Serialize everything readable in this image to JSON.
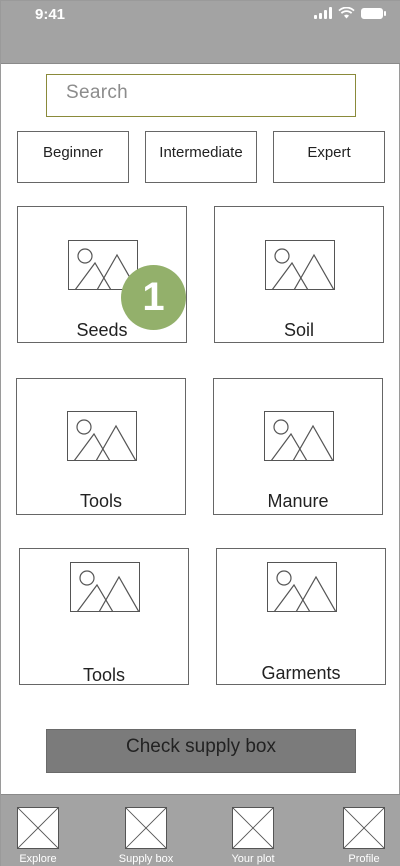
{
  "status_bar": {
    "time": "9:41",
    "icons": [
      "cellular-signal-icon",
      "wifi-icon",
      "battery-icon"
    ]
  },
  "search": {
    "placeholder": "Search"
  },
  "levels": [
    "Beginner",
    "Intermediate",
    "Expert"
  ],
  "cards": [
    {
      "label": "Seeds",
      "image": "image-placeholder-icon"
    },
    {
      "label": "Soil",
      "image": "image-placeholder-icon"
    },
    {
      "label": "Tools",
      "image": "image-placeholder-icon"
    },
    {
      "label": "Manure",
      "image": "image-placeholder-icon"
    },
    {
      "label": "Tools",
      "image": "image-placeholder-icon"
    },
    {
      "label": "Garments",
      "image": "image-placeholder-icon"
    }
  ],
  "annotation_badge": {
    "number": "1",
    "color": "#93b06b"
  },
  "cta": {
    "label": "Check supply box"
  },
  "tab_bar": {
    "items": [
      {
        "label": "Explore",
        "icon": "placeholder-x-icon"
      },
      {
        "label": "Supply box",
        "icon": "placeholder-x-icon"
      },
      {
        "label": "Your plot",
        "icon": "placeholder-x-icon"
      },
      {
        "label": "Profile",
        "icon": "placeholder-x-icon"
      }
    ]
  },
  "colors": {
    "bars": "#a3a3a3",
    "cta": "#7b7b7b",
    "badge": "#93b06b"
  }
}
